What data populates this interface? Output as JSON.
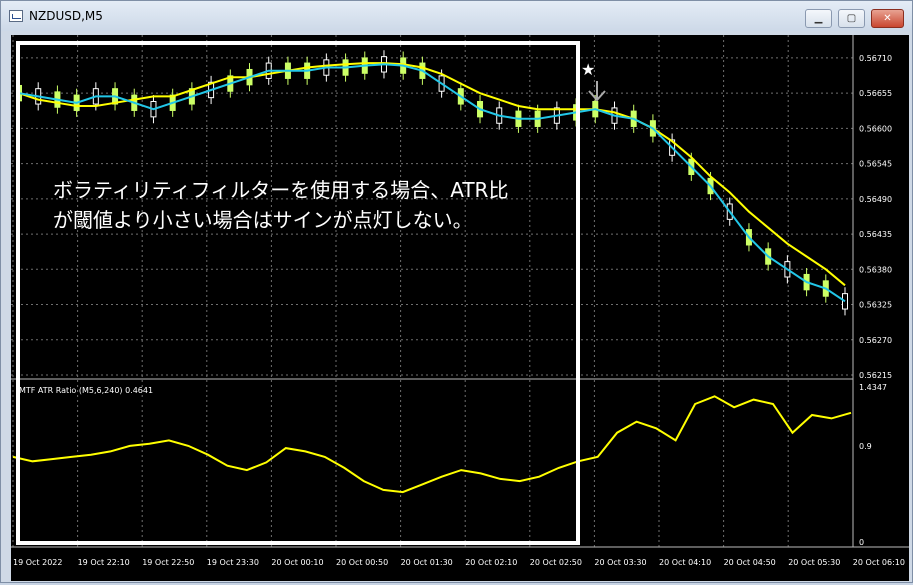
{
  "window": {
    "title": "NZDUSD,M5",
    "controls": [
      "minimize-icon",
      "maximize-icon",
      "close-icon"
    ]
  },
  "indicator_header": "MTF ATR Ratio (M5,6,240) 0.4641",
  "annotation": {
    "line1": "ボラティリティフィルターを使用する場合、ATR比",
    "line2": "が閾値より小さい場合はサインが点灯しない。"
  },
  "price_axis": [
    "0.56710",
    "0.56655",
    "0.56600",
    "0.56545",
    "0.56490",
    "0.56435",
    "0.56380",
    "0.56325",
    "0.56270",
    "0.56215"
  ],
  "indicator_axis": [
    "1.4347",
    "0.9",
    "0"
  ],
  "time_axis": [
    "19 Oct 2022",
    "19 Oct 22:10",
    "19 Oct 22:50",
    "19 Oct 23:30",
    "20 Oct 00:10",
    "20 Oct 00:50",
    "20 Oct 01:30",
    "20 Oct 02:10",
    "20 Oct 02:50",
    "20 Oct 03:30",
    "20 Oct 04:10",
    "20 Oct 04:50",
    "20 Oct 05:30",
    "20 Oct 06:10"
  ],
  "markers": {
    "star": "★"
  },
  "colors": {
    "bull": "#ccff66",
    "bear": "#ffffff",
    "ma_fast": "#22c7e8",
    "ma_slow": "#ffff00",
    "atr_line": "#ffff00",
    "box": "#ffffff"
  },
  "chart_data": {
    "type": "line",
    "price_range": [
      0.56215,
      0.56738
    ],
    "ma_fast": [
      0.56655,
      0.5665,
      0.56645,
      0.5664,
      0.5665,
      0.5665,
      0.5664,
      0.5663,
      0.5664,
      0.5665,
      0.5666,
      0.5667,
      0.5668,
      0.5669,
      0.5669,
      0.5669,
      0.56695,
      0.56695,
      0.56698,
      0.567,
      0.56698,
      0.5669,
      0.5667,
      0.5665,
      0.5663,
      0.5662,
      0.56615,
      0.56615,
      0.5662,
      0.56625,
      0.5663,
      0.5662,
      0.56615,
      0.566,
      0.5657,
      0.5654,
      0.5651,
      0.5647,
      0.5643,
      0.564,
      0.5638,
      0.5636,
      0.5635,
      0.5633
    ],
    "ma_slow": [
      0.56655,
      0.56645,
      0.5664,
      0.56635,
      0.56635,
      0.5664,
      0.56645,
      0.5665,
      0.5665,
      0.5666,
      0.5667,
      0.5668,
      0.5668,
      0.56685,
      0.5669,
      0.56695,
      0.56698,
      0.567,
      0.56702,
      0.56702,
      0.567,
      0.56695,
      0.56685,
      0.5667,
      0.56655,
      0.56645,
      0.56635,
      0.5663,
      0.5663,
      0.5663,
      0.5663,
      0.56625,
      0.56615,
      0.566,
      0.5658,
      0.56555,
      0.56525,
      0.565,
      0.5647,
      0.56445,
      0.5642,
      0.564,
      0.5638,
      0.56355
    ],
    "atr_ratio_range": [
      0,
      1.4347
    ],
    "atr_ratio": [
      0.8,
      0.76,
      0.78,
      0.8,
      0.82,
      0.85,
      0.9,
      0.92,
      0.95,
      0.9,
      0.82,
      0.72,
      0.68,
      0.75,
      0.88,
      0.85,
      0.8,
      0.7,
      0.58,
      0.5,
      0.48,
      0.55,
      0.62,
      0.68,
      0.65,
      0.6,
      0.58,
      0.62,
      0.7,
      0.76,
      0.8,
      1.02,
      1.12,
      1.06,
      0.95,
      1.28,
      1.35,
      1.25,
      1.32,
      1.28,
      1.02,
      1.18,
      1.15,
      1.2
    ]
  }
}
